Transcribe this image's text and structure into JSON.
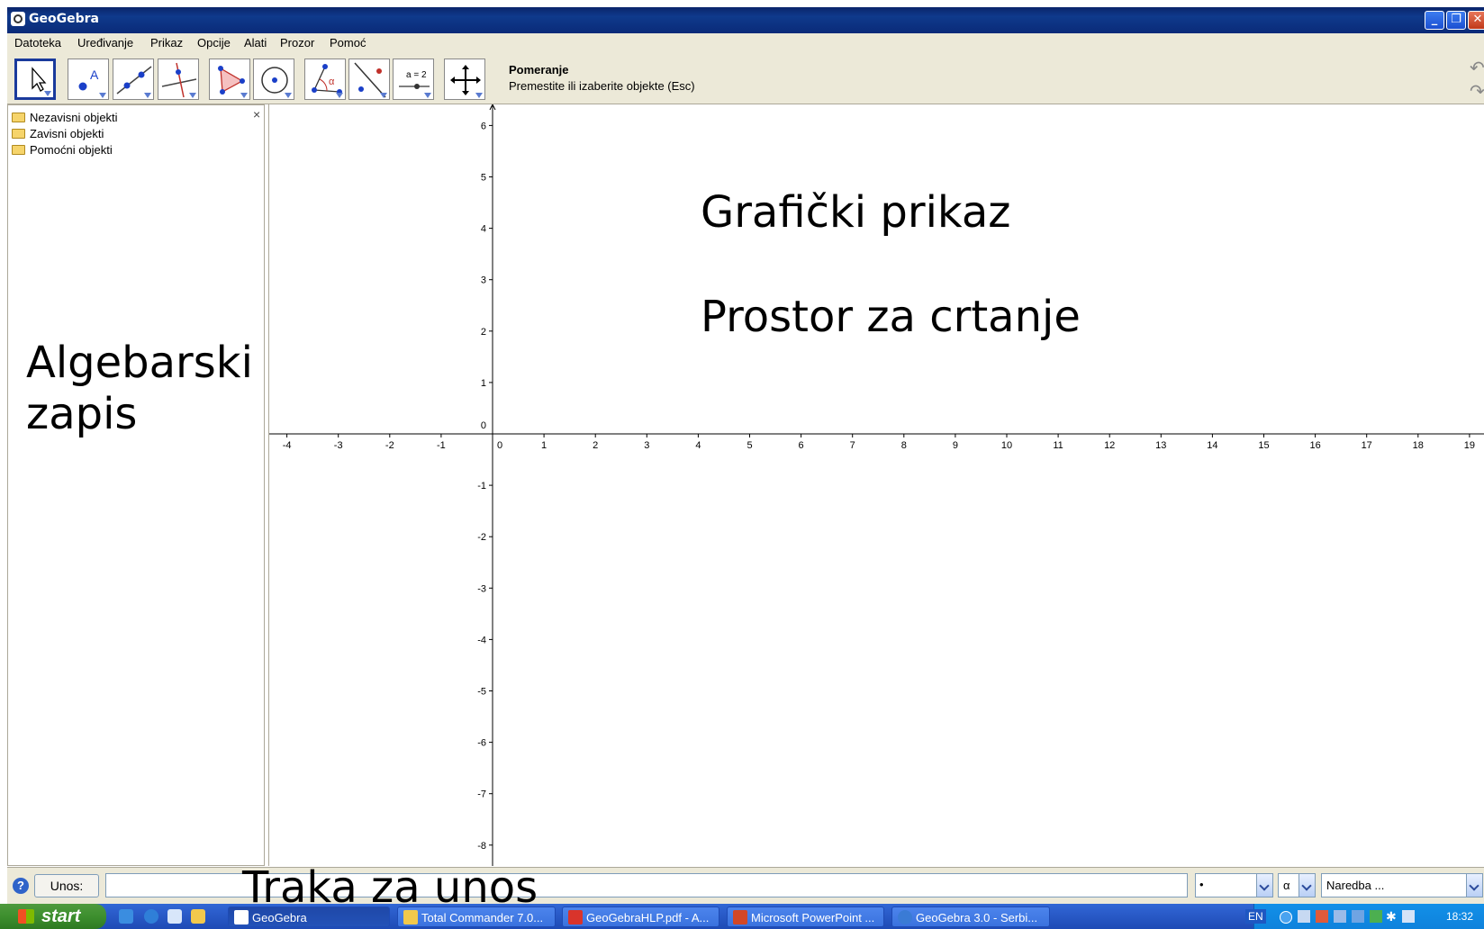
{
  "window": {
    "title": "GeoGebra"
  },
  "menu": [
    "Datoteka",
    "Uređivanje",
    "Prikaz",
    "Opcije",
    "Alati",
    "Prozor",
    "Pomoć"
  ],
  "toolbar": {
    "tools": [
      {
        "name": "move-tool",
        "icon": "pointer-icon"
      },
      {
        "name": "new-point-tool",
        "icon": "point-icon"
      },
      {
        "name": "line-tool",
        "icon": "line-icon"
      },
      {
        "name": "perpendicular-line-tool",
        "icon": "perpendicular-icon"
      },
      {
        "name": "polygon-tool",
        "icon": "polygon-icon"
      },
      {
        "name": "circle-tool",
        "icon": "circle-icon"
      },
      {
        "name": "angle-tool",
        "icon": "angle-icon"
      },
      {
        "name": "reflect-tool",
        "icon": "reflect-icon"
      },
      {
        "name": "slider-tool",
        "icon": "slider-icon"
      },
      {
        "name": "move-view-tool",
        "icon": "move-view-icon"
      }
    ],
    "slider_label": "a = 2",
    "selected_tool_name": "Pomeranje",
    "selected_tool_help": "Premestite ili izaberite objekte (Esc)"
  },
  "algebra": {
    "folders": [
      "Nezavisni objekti",
      "Zavisni objekti",
      "Pomoćni objekti"
    ],
    "close": "×",
    "overlay_label_line1": "Algebarski",
    "overlay_label_line2": "zapis"
  },
  "graphics": {
    "overlay_line1": "Grafički prikaz",
    "overlay_line2": "Prostor za crtanje",
    "x_ticks": [
      "-4",
      "-3",
      "-2",
      "-1",
      "0",
      "1",
      "2",
      "3",
      "4",
      "5",
      "6",
      "7",
      "8",
      "9",
      "10",
      "11",
      "12",
      "13",
      "14",
      "15",
      "16",
      "17",
      "18",
      "19"
    ],
    "y_ticks": [
      "6",
      "5",
      "4",
      "3",
      "2",
      "1",
      "0",
      "-1",
      "-2",
      "-3",
      "-4",
      "-5",
      "-6",
      "-7",
      "-8"
    ]
  },
  "input_bar": {
    "help": "?",
    "button_label": "Unos:",
    "value": "",
    "overlay_label": "Traka za unos",
    "symbol_combo": "•",
    "greek_combo": "α",
    "command_combo": "Naredba ..."
  },
  "taskbar": {
    "start": "start",
    "tasks": [
      {
        "label": "GeoGebra",
        "icon_color": "#ffffff"
      },
      {
        "label": "Total Commander 7.0...",
        "icon_color": "#f2c94c"
      },
      {
        "label": "GeoGebraHLP.pdf - A...",
        "icon_color": "#d9342b"
      },
      {
        "label": "Microsoft PowerPoint ...",
        "icon_color": "#d24726"
      },
      {
        "label": "GeoGebra 3.0 - Serbi...",
        "icon_color": "#3a7bd5"
      }
    ],
    "language": "EN",
    "clock": "18:32"
  }
}
